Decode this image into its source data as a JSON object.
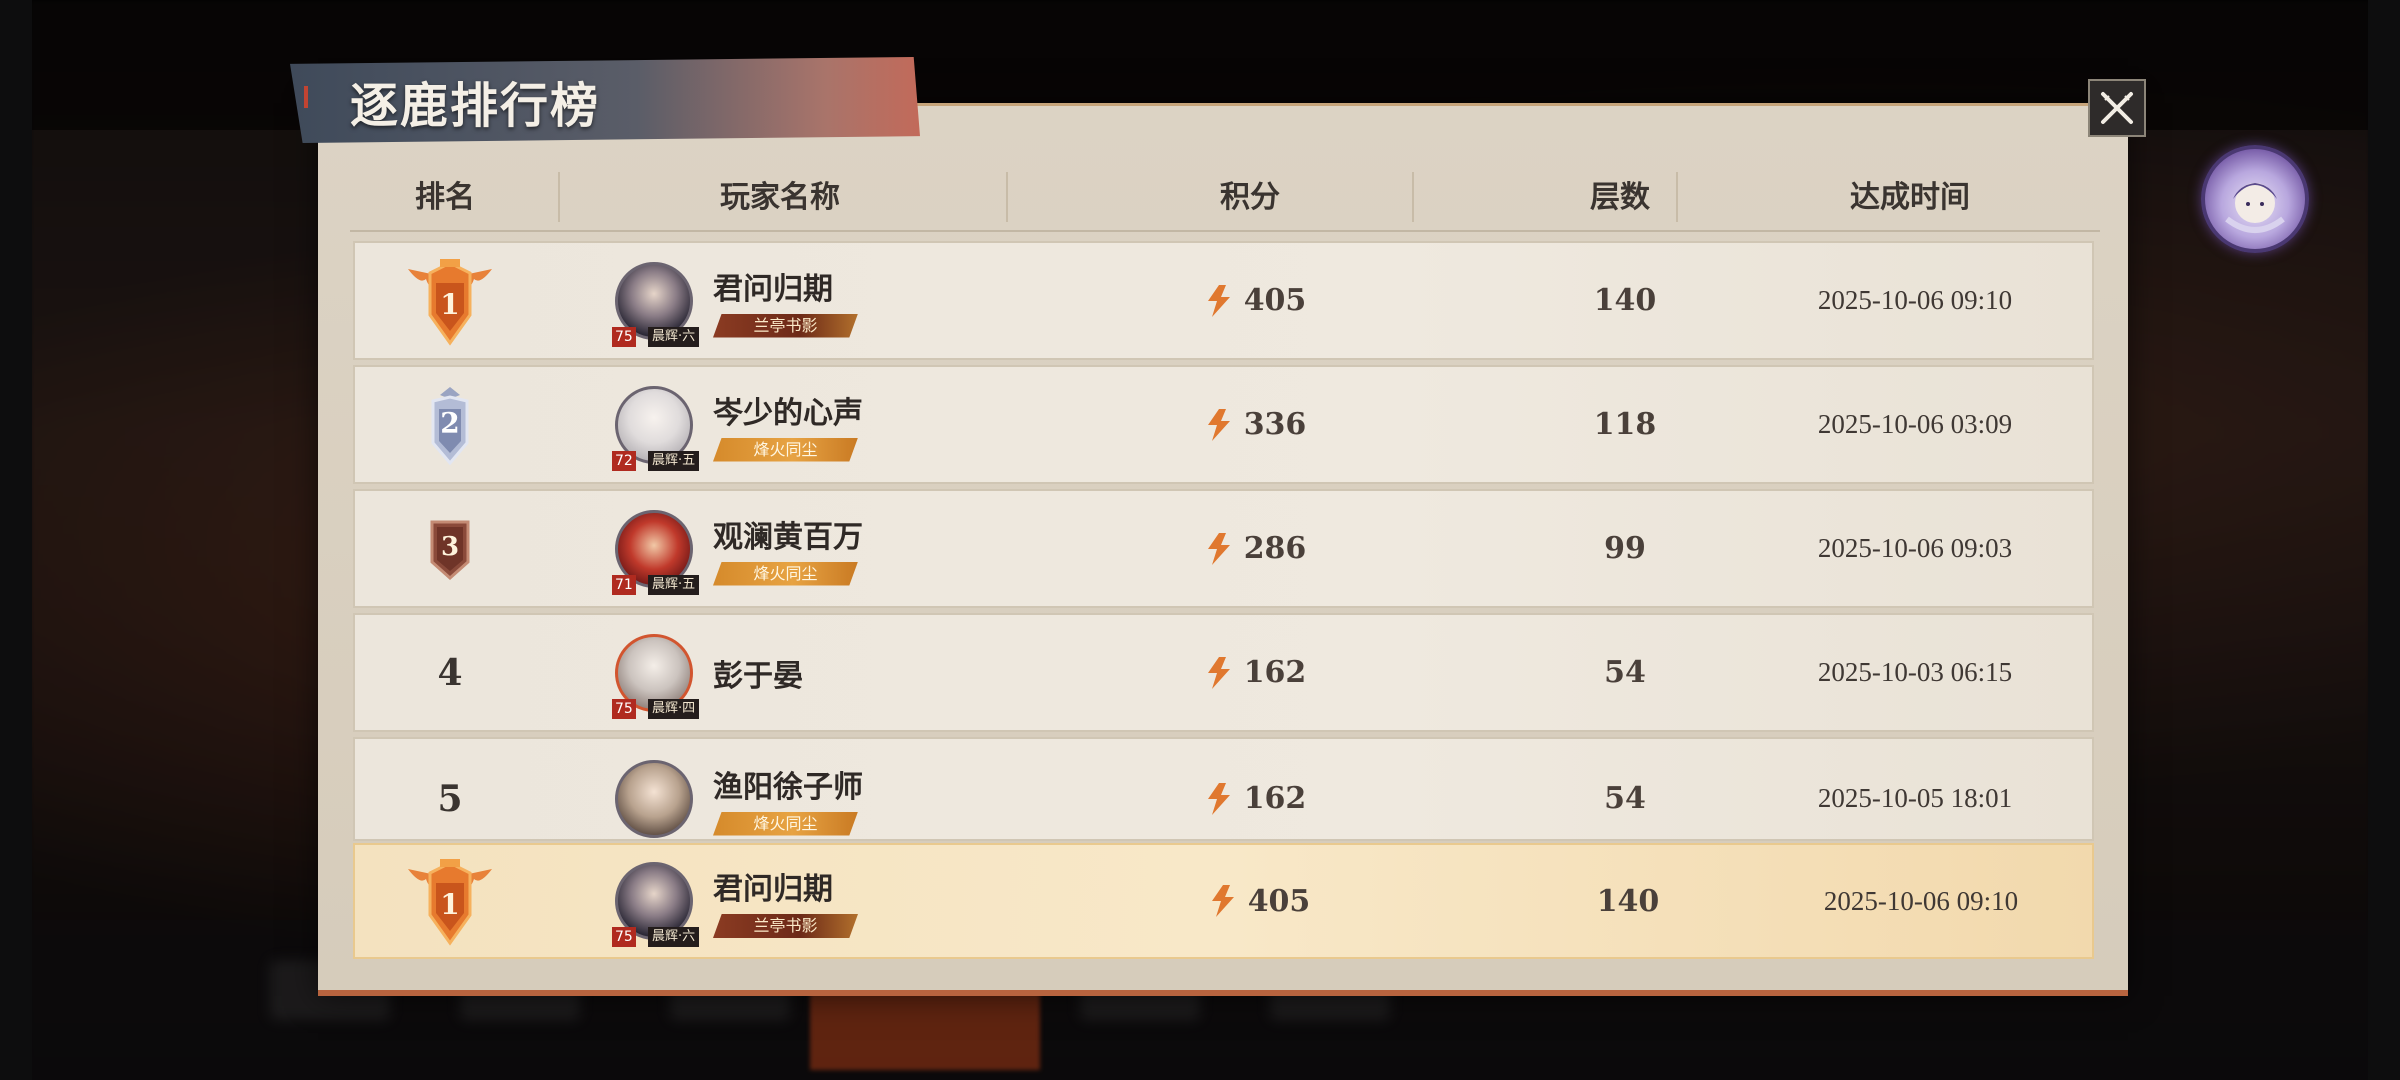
{
  "title": "逐鹿排行榜",
  "columns": {
    "rank": "排名",
    "player": "玩家名称",
    "score": "积分",
    "floors": "层数",
    "time": "达成时间"
  },
  "rows": [
    {
      "rank": "1",
      "name": "君问归期",
      "level": "75",
      "honor": "晨辉·六",
      "guild": "兰亭书影",
      "score": "405",
      "floors": "140",
      "time": "2025-10-06 09:10"
    },
    {
      "rank": "2",
      "name": "岑少的心声",
      "level": "72",
      "honor": "晨辉·五",
      "guild": "烽火同尘",
      "score": "336",
      "floors": "118",
      "time": "2025-10-06 03:09"
    },
    {
      "rank": "3",
      "name": "观澜黄百万",
      "level": "71",
      "honor": "晨辉·五",
      "guild": "烽火同尘",
      "score": "286",
      "floors": "99",
      "time": "2025-10-06 09:03"
    },
    {
      "rank": "4",
      "name": "彭于晏",
      "level": "75",
      "honor": "晨辉·四",
      "guild": "",
      "score": "162",
      "floors": "54",
      "time": "2025-10-03 06:15"
    },
    {
      "rank": "5",
      "name": "渔阳徐子师",
      "level": "",
      "honor": "",
      "guild": "烽火同尘",
      "score": "162",
      "floors": "54",
      "time": "2025-10-05 18:01"
    }
  ],
  "my_row": {
    "rank": "1",
    "name": "君问归期",
    "level": "75",
    "honor": "晨辉·六",
    "guild": "兰亭书影",
    "score": "405",
    "floors": "140",
    "time": "2025-10-06 09:10"
  },
  "icons": {
    "close": "close-x-icon",
    "score": "score-flame-icon",
    "rank_badges": [
      "gold-crest-badge",
      "silver-crest-badge",
      "bronze-crest-badge"
    ]
  },
  "colors": {
    "accent_orange": "#e0782f",
    "highlight_row": "#f8e8c8",
    "panel": "#dcd3c4"
  }
}
